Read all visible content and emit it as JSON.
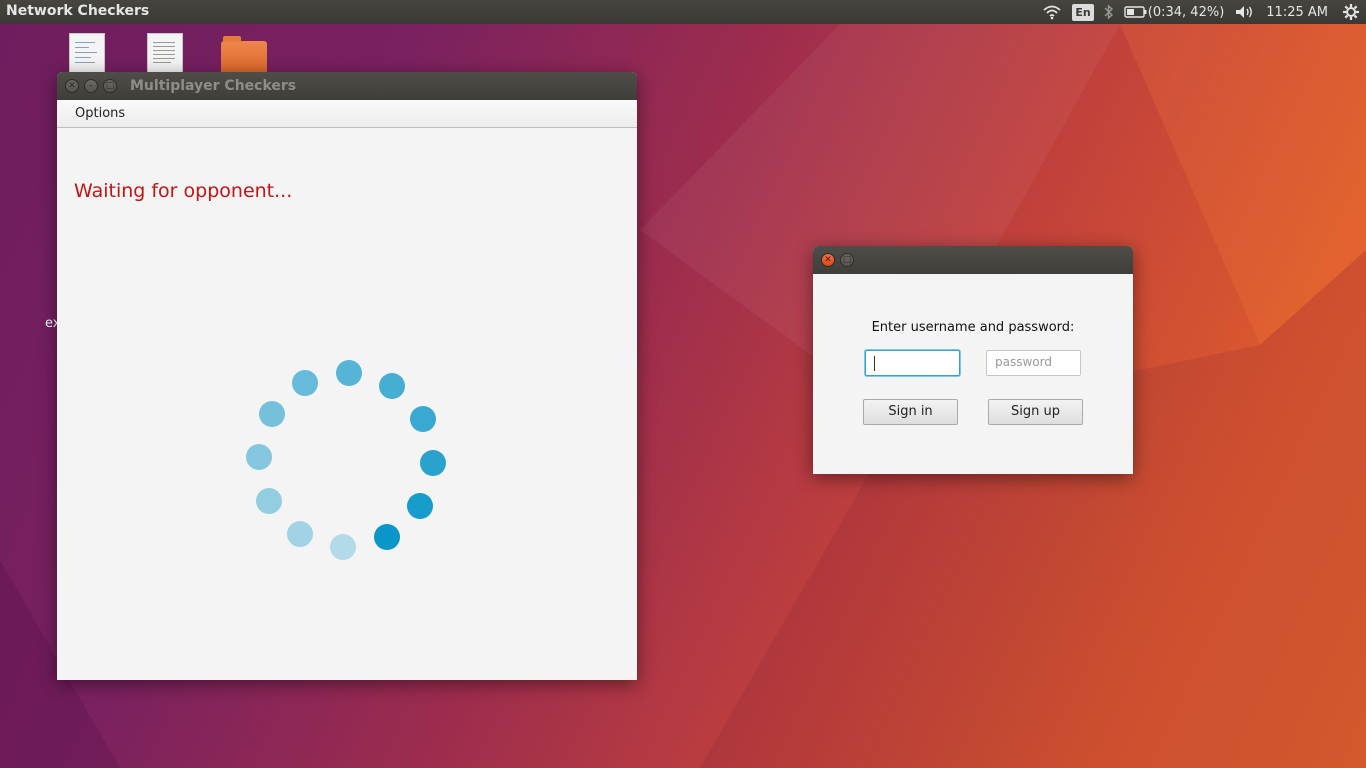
{
  "top_panel": {
    "app_title": "Network Checkers",
    "keyboard_layout": "En",
    "battery_text": "(0:34, 42%)",
    "clock": "11:25 AM"
  },
  "desktop": {
    "partial_label": "ex"
  },
  "game_window": {
    "title": "Multiplayer Checkers",
    "menu": {
      "options_label": "Options"
    },
    "status_text": "Waiting for opponent...",
    "status_color": "#c41414",
    "spinner_color": "#0a96c8"
  },
  "login_dialog": {
    "prompt": "Enter username and password:",
    "username": {
      "value": "",
      "placeholder": ""
    },
    "password": {
      "value": "",
      "placeholder": "password"
    },
    "sign_in_label": "Sign in",
    "sign_up_label": "Sign up"
  }
}
